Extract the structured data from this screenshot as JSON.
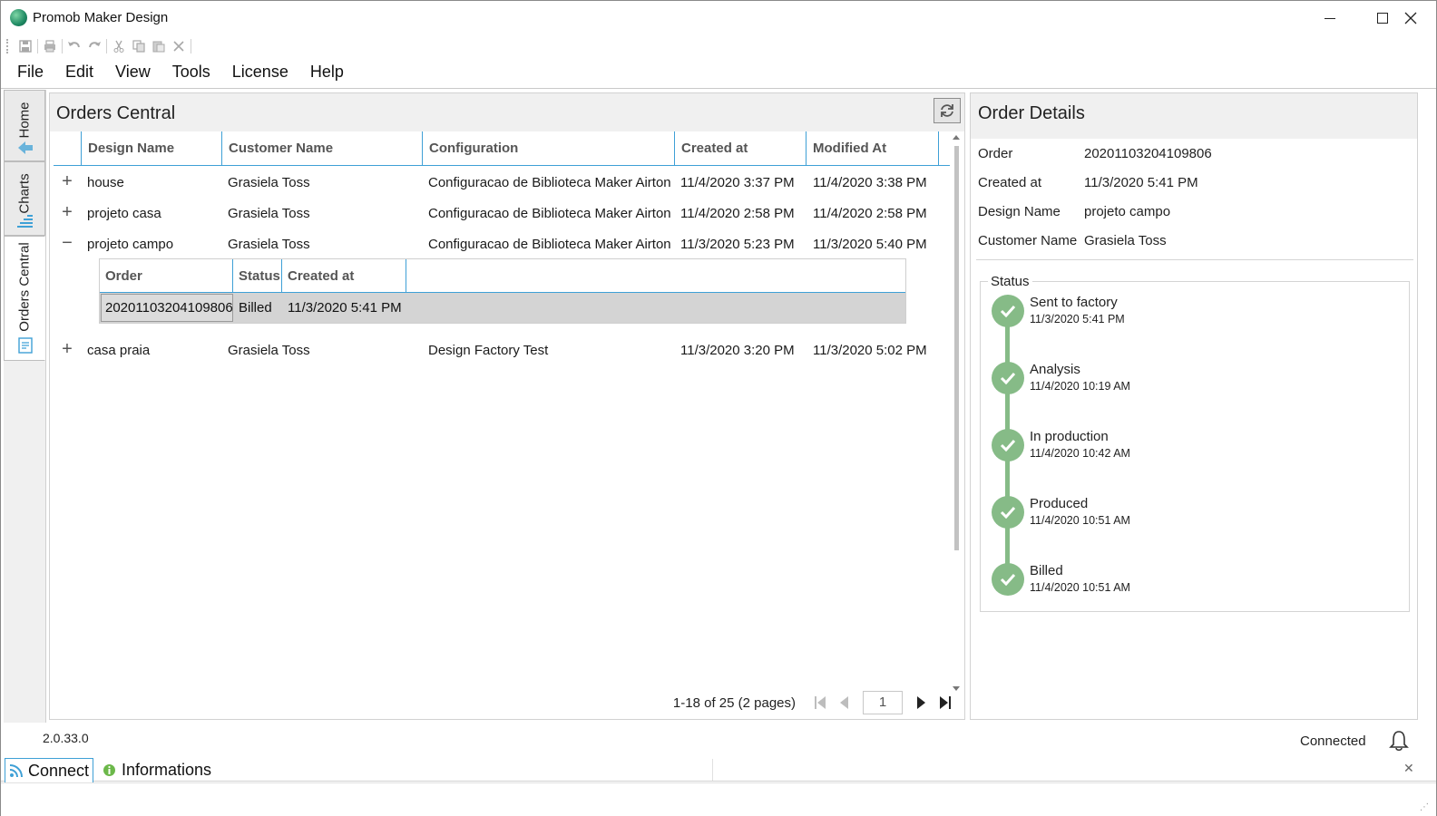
{
  "app": {
    "title": "Promob Maker Design",
    "version": "2.0.33.0"
  },
  "toolbar": [
    "save-icon",
    "print-icon",
    "undo-icon",
    "redo-icon",
    "cut-icon",
    "copy-icon",
    "paste-icon",
    "delete-icon"
  ],
  "menu": [
    "File",
    "Edit",
    "View",
    "Tools",
    "License",
    "Help"
  ],
  "sidetabs": {
    "home": "Home",
    "charts": "Charts",
    "orders": "Orders Central"
  },
  "orders": {
    "title": "Orders Central",
    "columns": [
      "Design Name",
      "Customer Name",
      "Configuration",
      "Created at",
      "Modified At"
    ],
    "rows": [
      {
        "expander": "+",
        "design": "house",
        "customer": "Grasiela Toss",
        "config": "Configuracao de Biblioteca Maker Airton",
        "created": "11/4/2020 3:37 PM",
        "modified": "11/4/2020 3:38 PM"
      },
      {
        "expander": "+",
        "design": "projeto casa",
        "customer": "Grasiela Toss",
        "config": "Configuracao de Biblioteca Maker Airton",
        "created": "11/4/2020 2:58 PM",
        "modified": "11/4/2020 2:58 PM"
      },
      {
        "expander": "−",
        "design": "projeto campo",
        "customer": "Grasiela Toss",
        "config": "Configuracao de Biblioteca Maker Airton",
        "created": "11/3/2020 5:23 PM",
        "modified": "11/3/2020 5:40 PM"
      },
      {
        "expander": "+",
        "design": "casa praia",
        "customer": "Grasiela Toss",
        "config": "Design Factory Test",
        "created": "11/3/2020 3:20 PM",
        "modified": "11/3/2020 5:02 PM"
      }
    ],
    "subgrid": {
      "columns": [
        "Order",
        "Status",
        "Created at"
      ],
      "row": {
        "order": "20201103204109806",
        "status": "Billed",
        "created": "11/3/2020 5:41 PM"
      }
    },
    "pager": {
      "summary": "1-18 of 25 (2 pages)",
      "page": "1"
    }
  },
  "details": {
    "title": "Order Details",
    "fields": [
      {
        "label": "Order",
        "value": "20201103204109806"
      },
      {
        "label": "Created at",
        "value": "11/3/2020 5:41 PM"
      },
      {
        "label": "Design Name",
        "value": "projeto campo"
      },
      {
        "label": "Customer Name",
        "value": "Grasiela Toss"
      }
    ],
    "status_label": "Status",
    "steps": [
      {
        "name": "Sent to factory",
        "date": "11/3/2020 5:41 PM"
      },
      {
        "name": "Analysis",
        "date": "11/4/2020 10:19 AM"
      },
      {
        "name": "In production",
        "date": "11/4/2020 10:42 AM"
      },
      {
        "name": "Produced",
        "date": "11/4/2020 10:51 AM"
      },
      {
        "name": "Billed",
        "date": "11/4/2020 10:51 AM"
      }
    ],
    "step_color": "#86bb87"
  },
  "footer": {
    "connection": "Connected",
    "tabs": [
      "Connect",
      "Informations"
    ]
  },
  "colors": {
    "accent": "#3ea0d6",
    "panel_header": "#f0f0f0"
  }
}
